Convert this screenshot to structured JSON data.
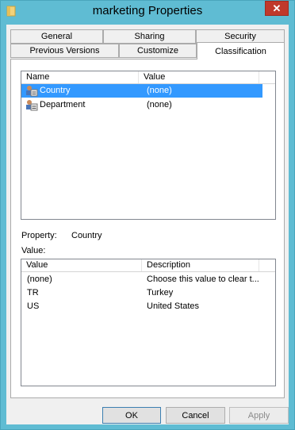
{
  "window": {
    "title": "marketing Properties",
    "close_symbol": "✕"
  },
  "tabs": {
    "row1": [
      "General",
      "Sharing",
      "Security"
    ],
    "row2": [
      "Previous Versions",
      "Customize"
    ],
    "selected": "Classification"
  },
  "properties_list": {
    "headers": [
      "Name",
      "Value"
    ],
    "rows": [
      {
        "name": "Country",
        "value": "(none)",
        "icon": "user-property-icon"
      },
      {
        "name": "Department",
        "value": "(none)",
        "icon": "user-property-icon"
      }
    ]
  },
  "property_label": "Property:",
  "property_value": "Country",
  "value_label": "Value:",
  "values_list": {
    "headers": [
      "Value",
      "Description"
    ],
    "rows": [
      {
        "value": "(none)",
        "description": "Choose this value to clear t..."
      },
      {
        "value": "TR",
        "description": "Turkey"
      },
      {
        "value": "US",
        "description": "United States"
      }
    ]
  },
  "buttons": {
    "ok": "OK",
    "cancel": "Cancel",
    "apply": "Apply"
  },
  "colors": {
    "frame": "#5fbcd3",
    "selection": "#3399ff",
    "close": "#c0392b"
  }
}
